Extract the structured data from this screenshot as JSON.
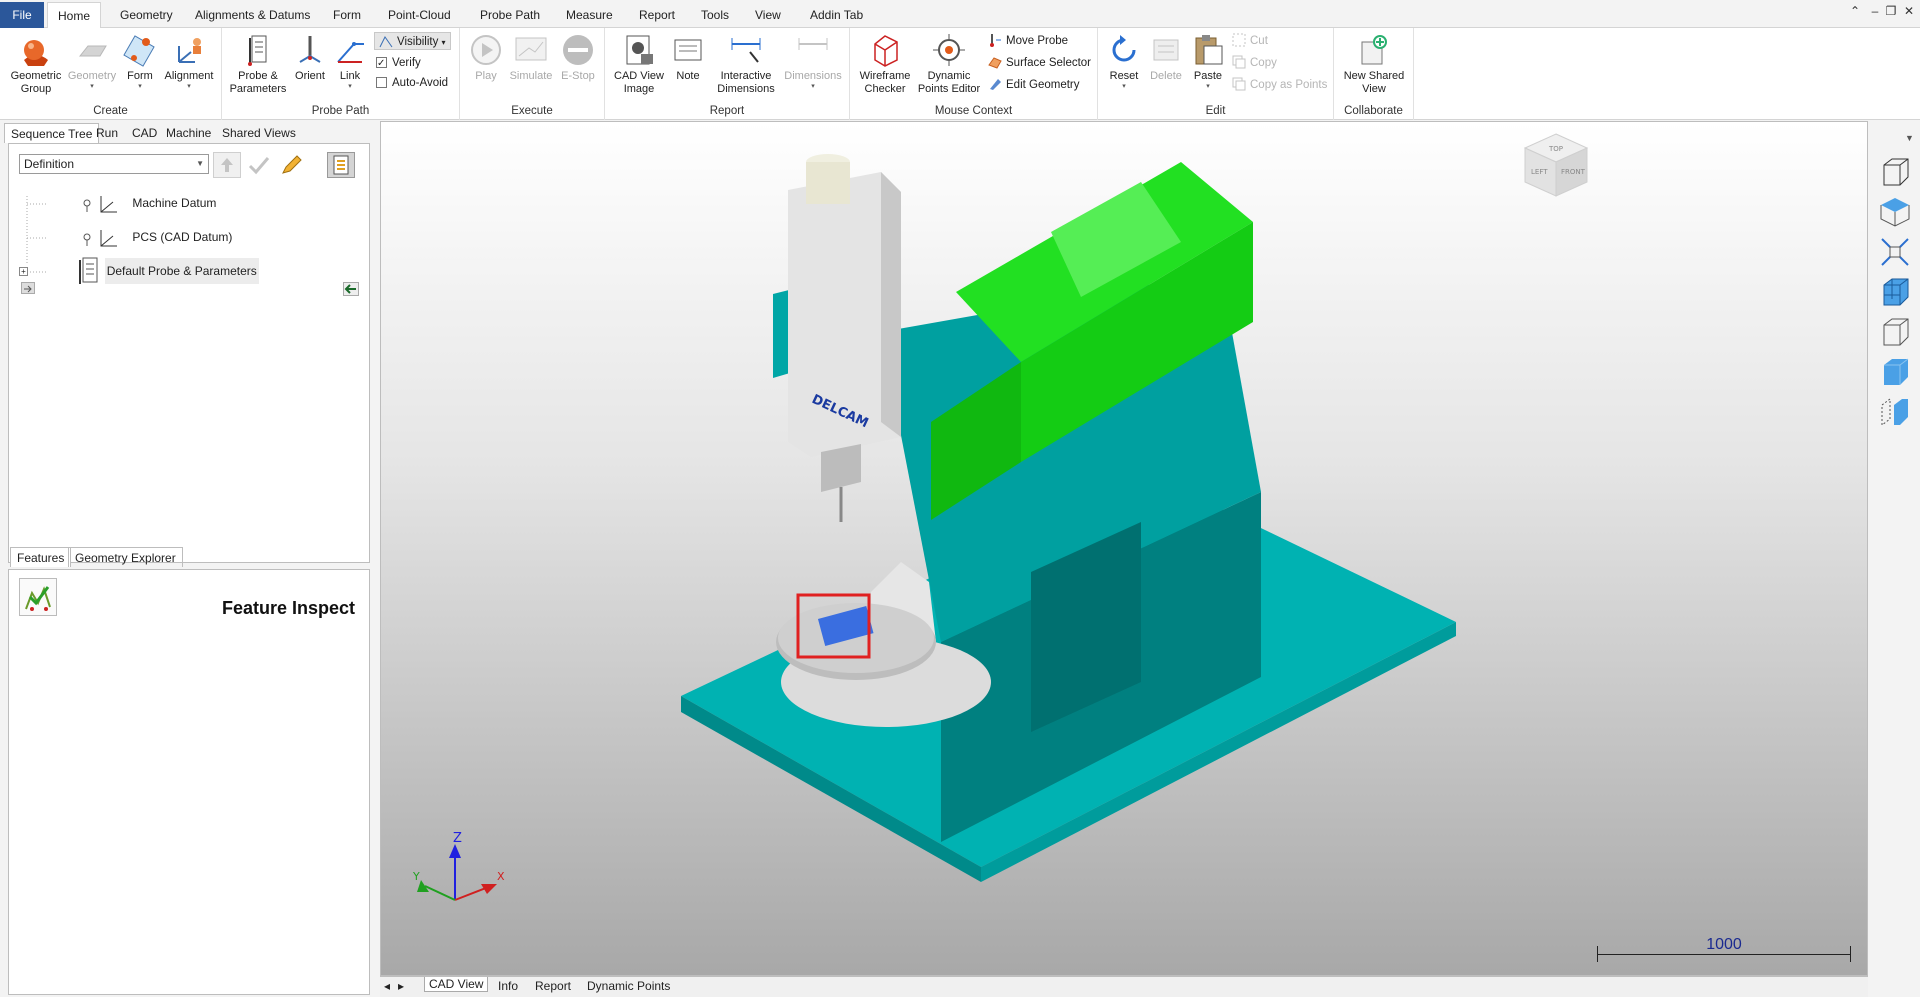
{
  "menu": {
    "file": "File",
    "tabs": [
      "Home",
      "Geometry",
      "Alignments & Datums",
      "Form",
      "Point-Cloud",
      "Probe Path",
      "Measure",
      "Report",
      "Tools",
      "View",
      "Addin Tab"
    ],
    "active_tab": "Home"
  },
  "window_controls": {
    "up": "⌃",
    "minimize": "–",
    "restore": "❐",
    "close": "✕"
  },
  "ribbon": {
    "create": {
      "label": "Create",
      "geometric_group": "Geometric Group",
      "geometry": "Geometry",
      "form": "Form",
      "alignment": "Alignment"
    },
    "probe_path": {
      "label": "Probe Path",
      "probe_params": "Probe & Parameters",
      "orient": "Orient",
      "link": "Link",
      "visibility": "Visibility",
      "verify": "Verify",
      "auto_avoid": "Auto-Avoid",
      "verify_checked": true,
      "auto_avoid_checked": false
    },
    "execute": {
      "label": "Execute",
      "play": "Play",
      "simulate": "Simulate",
      "estop": "E-Stop"
    },
    "report": {
      "label": "Report",
      "cad_view_image": "CAD View Image",
      "note": "Note",
      "interactive_dimensions": "Interactive Dimensions",
      "dimensions": "Dimensions"
    },
    "mouse_context": {
      "label": "Mouse Context",
      "wireframe_checker": "Wireframe Checker",
      "dynamic_points_editor": "Dynamic Points Editor",
      "move_probe": "Move Probe",
      "surface_selector": "Surface Selector",
      "edit_geometry": "Edit Geometry"
    },
    "edit": {
      "label": "Edit",
      "reset": "Reset",
      "delete": "Delete",
      "paste": "Paste",
      "cut": "Cut",
      "copy": "Copy",
      "copy_as_points": "Copy as Points"
    },
    "collaborate": {
      "label": "Collaborate",
      "new_shared_view": "New Shared View"
    }
  },
  "left_panel": {
    "tabs": [
      "Sequence Tree",
      "Run",
      "CAD",
      "Machine",
      "Shared Views"
    ],
    "definition_value": "Definition",
    "tree": [
      "Machine Datum",
      "PCS (CAD Datum)",
      "Default Probe & Parameters"
    ],
    "bottom_tabs": [
      "Features",
      "Geometry Explorer"
    ],
    "feature_title": "Feature Inspect"
  },
  "viewport": {
    "scale_label": "1000",
    "axes": {
      "x": "X",
      "y": "Y",
      "z": "Z"
    },
    "viewcube": {
      "top": "TOP",
      "left": "LEFT",
      "front": "FRONT"
    },
    "logo": "DELCAM",
    "colors": {
      "machine_base": "#00a9a9",
      "machine_column": "#007f7f",
      "gantry": "#19e019",
      "head": "#e8e8e8",
      "highlight": "#e02020"
    }
  },
  "bottom_tabs": [
    "CAD View",
    "Info",
    "Report",
    "Dynamic Points"
  ]
}
